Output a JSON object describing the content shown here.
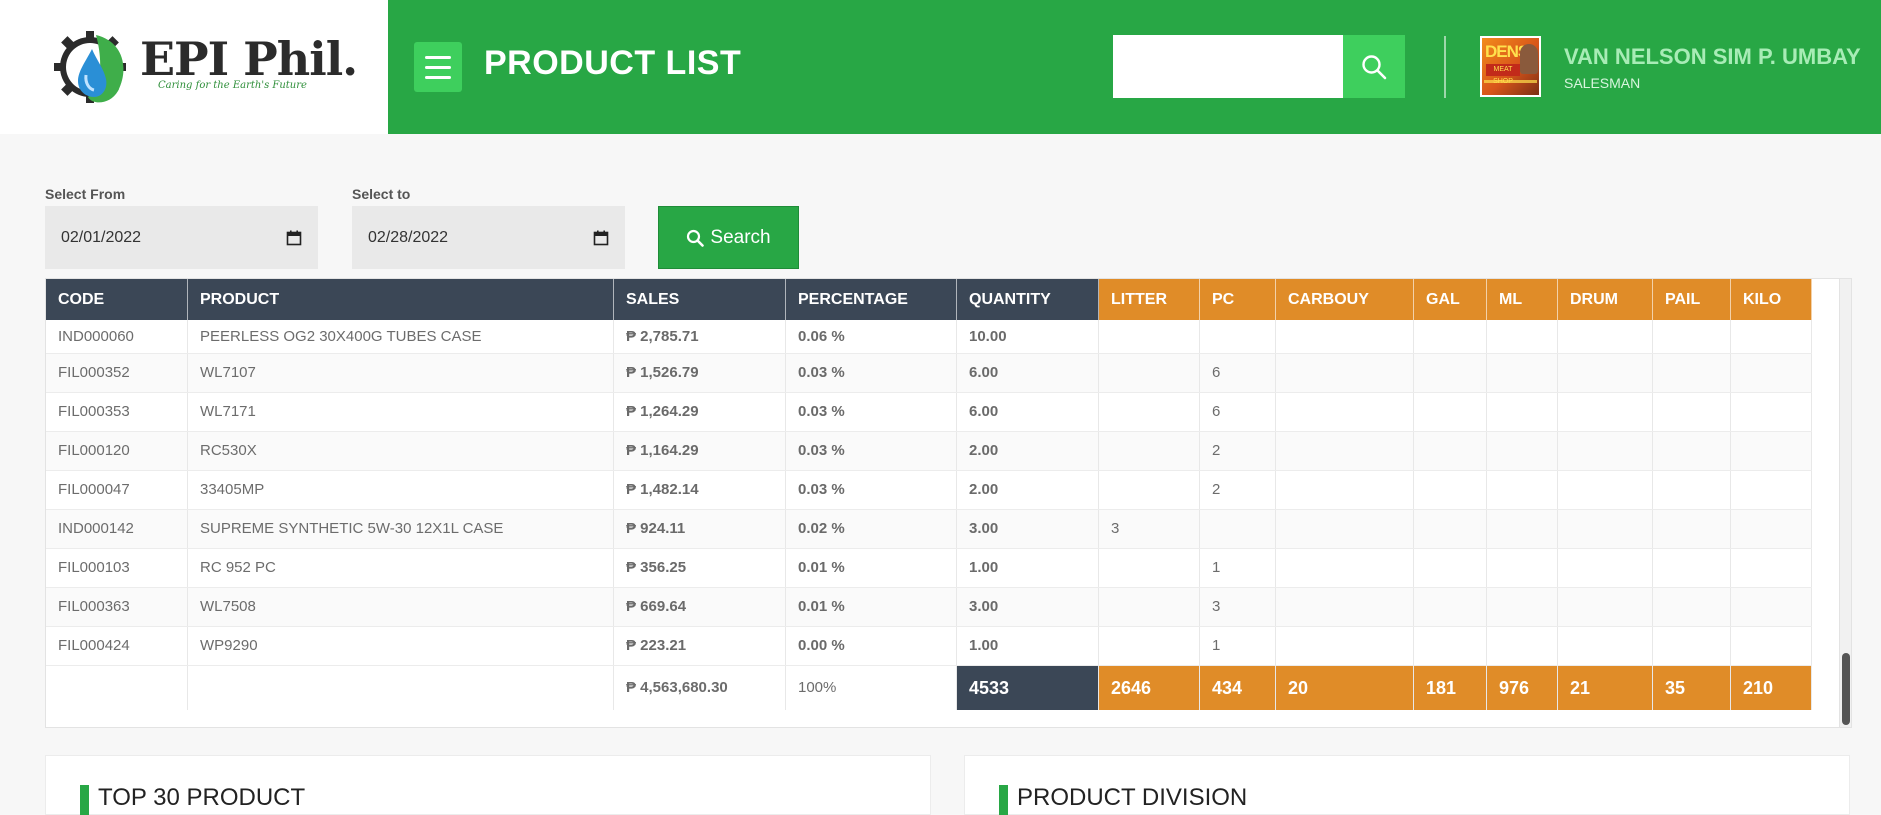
{
  "brand": {
    "name": "EPI Phil.",
    "tagline": "Caring for the Earth's Future"
  },
  "header": {
    "title": "PRODUCT LIST",
    "search_value": ""
  },
  "user": {
    "name": "VAN NELSON SIM P. UMBAY",
    "role": "SALESMAN",
    "avatar_text": "DENS",
    "avatar_subtext": "MEAT SHOP"
  },
  "filters": {
    "from_label": "Select From",
    "from_value": "02/01/2022",
    "to_label": "Select to",
    "to_value": "02/28/2022",
    "search_label": "Search"
  },
  "table": {
    "columns": [
      "CODE",
      "PRODUCT",
      "SALES",
      "PERCENTAGE",
      "QUANTITY",
      "LITTER",
      "PC",
      "CARBOUY",
      "GAL",
      "ML",
      "DRUM",
      "PAIL",
      "KILO"
    ],
    "rows": [
      [
        "IND000060",
        "PEERLESS OG2 30X400G TUBES CASE",
        "₱ 2,785.71",
        "0.06 %",
        "10.00",
        "",
        "",
        "",
        "",
        "",
        "",
        "",
        ""
      ],
      [
        "FIL000352",
        "WL7107",
        "₱ 1,526.79",
        "0.03 %",
        "6.00",
        "",
        "6",
        "",
        "",
        "",
        "",
        "",
        ""
      ],
      [
        "FIL000353",
        "WL7171",
        "₱ 1,264.29",
        "0.03 %",
        "6.00",
        "",
        "6",
        "",
        "",
        "",
        "",
        "",
        ""
      ],
      [
        "FIL000120",
        "RC530X",
        "₱ 1,164.29",
        "0.03 %",
        "2.00",
        "",
        "2",
        "",
        "",
        "",
        "",
        "",
        ""
      ],
      [
        "FIL000047",
        "33405MP",
        "₱ 1,482.14",
        "0.03 %",
        "2.00",
        "",
        "2",
        "",
        "",
        "",
        "",
        "",
        ""
      ],
      [
        "IND000142",
        "SUPREME SYNTHETIC 5W-30 12X1L CASE",
        "₱ 924.11",
        "0.02 %",
        "3.00",
        "3",
        "",
        "",
        "",
        "",
        "",
        "",
        ""
      ],
      [
        "FIL000103",
        "RC 952 PC",
        "₱ 356.25",
        "0.01 %",
        "1.00",
        "",
        "1",
        "",
        "",
        "",
        "",
        "",
        ""
      ],
      [
        "FIL000363",
        "WL7508",
        "₱ 669.64",
        "0.01 %",
        "3.00",
        "",
        "3",
        "",
        "",
        "",
        "",
        "",
        ""
      ],
      [
        "FIL000424",
        "WP9290",
        "₱ 223.21",
        "0.00 %",
        "1.00",
        "",
        "1",
        "",
        "",
        "",
        "",
        "",
        ""
      ]
    ],
    "totals": [
      "",
      "",
      "₱ 4,563,680.30",
      "100%",
      "4533",
      "2646",
      "434",
      "20",
      "181",
      "976",
      "21",
      "35",
      "210"
    ]
  },
  "panels": {
    "left_title": "TOP 30 PRODUCT",
    "right_title": "PRODUCT DIVISION"
  },
  "colors": {
    "green": "#28a745",
    "green_light": "#3ecf5d",
    "dark_header": "#3b4756",
    "orange_header": "#e08c28"
  }
}
